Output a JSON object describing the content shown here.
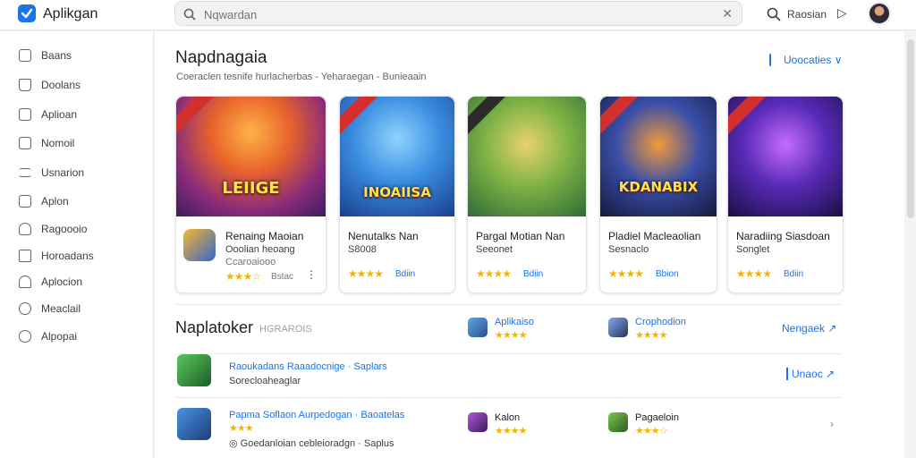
{
  "app": {
    "title": "Aplikgan"
  },
  "search": {
    "placeholder": "Nqwardan",
    "clear_glyph": "✕"
  },
  "topbar": {
    "label": "Raosian",
    "chevron": "▷"
  },
  "sidebar": {
    "items": [
      {
        "label": "Baans"
      },
      {
        "label": "Doolans"
      },
      {
        "label": "Aplioan"
      },
      {
        "label": "Nomoil"
      },
      {
        "label": "Usnarion"
      },
      {
        "label": "Aplon"
      },
      {
        "label": "Ragoooio"
      },
      {
        "label": "Horoadans"
      },
      {
        "label": "Aplocion"
      },
      {
        "label": "Meaclail"
      },
      {
        "label": "Alpopai"
      }
    ]
  },
  "section1": {
    "title": "Napdnagaia",
    "subtitle": "Coeraclen tesnife hurlacherbas - Yeharaegan - Bunieaain",
    "see_more": "Uoocaties ∨",
    "cards": [
      {
        "art_text": "LEIIGE",
        "name": "Renaing Maoian",
        "dev": "Ooolian heoang",
        "extra": "Ccaroaiooo",
        "stars": "★★★☆",
        "rating": "Bstac",
        "dots": "⋮"
      },
      {
        "art_text": "INOAIISA",
        "name": "Nenutalks Nan",
        "dev": "S8008",
        "stars": "★★★★",
        "rating": "Bdiin"
      },
      {
        "art_text": "",
        "name": "Pargal Motian Nan",
        "dev": "Seeonet",
        "stars": "★★★★",
        "rating": "Bdiin"
      },
      {
        "art_text": "KDANABIX",
        "name": "Pladiel Macleaolian",
        "dev": "Sesnaclo",
        "stars": "★★★★",
        "rating": "Bbion"
      },
      {
        "art_text": "",
        "name": "Naradiing Siasdoan",
        "dev": "Songlet",
        "stars": "★★★★",
        "rating": "Bdiin"
      }
    ]
  },
  "section2": {
    "title": "Naplatoker",
    "subtitle": "HGRAROIS",
    "mini_apps": [
      {
        "name": "Aplikaiso",
        "stars": "★★★★"
      },
      {
        "name": "Crophodion",
        "stars": "★★★★"
      },
      {
        "name": "Kalon",
        "stars": "★★★★"
      },
      {
        "name": "Pagaeloin",
        "stars": "★★★☆"
      }
    ],
    "right_link": "Nengaek ↗",
    "list": [
      {
        "title": "Raoukadans Raaadocnige · Saplars",
        "sub": "Sorecloaheaglar",
        "link": "Unaoc ↗"
      },
      {
        "title": "Papma Soflaon Aurpedogan · Baoatelas",
        "sub": "◎ Goedanloian cebleioradgn · Saplus",
        "stars": "★★★"
      }
    ]
  }
}
